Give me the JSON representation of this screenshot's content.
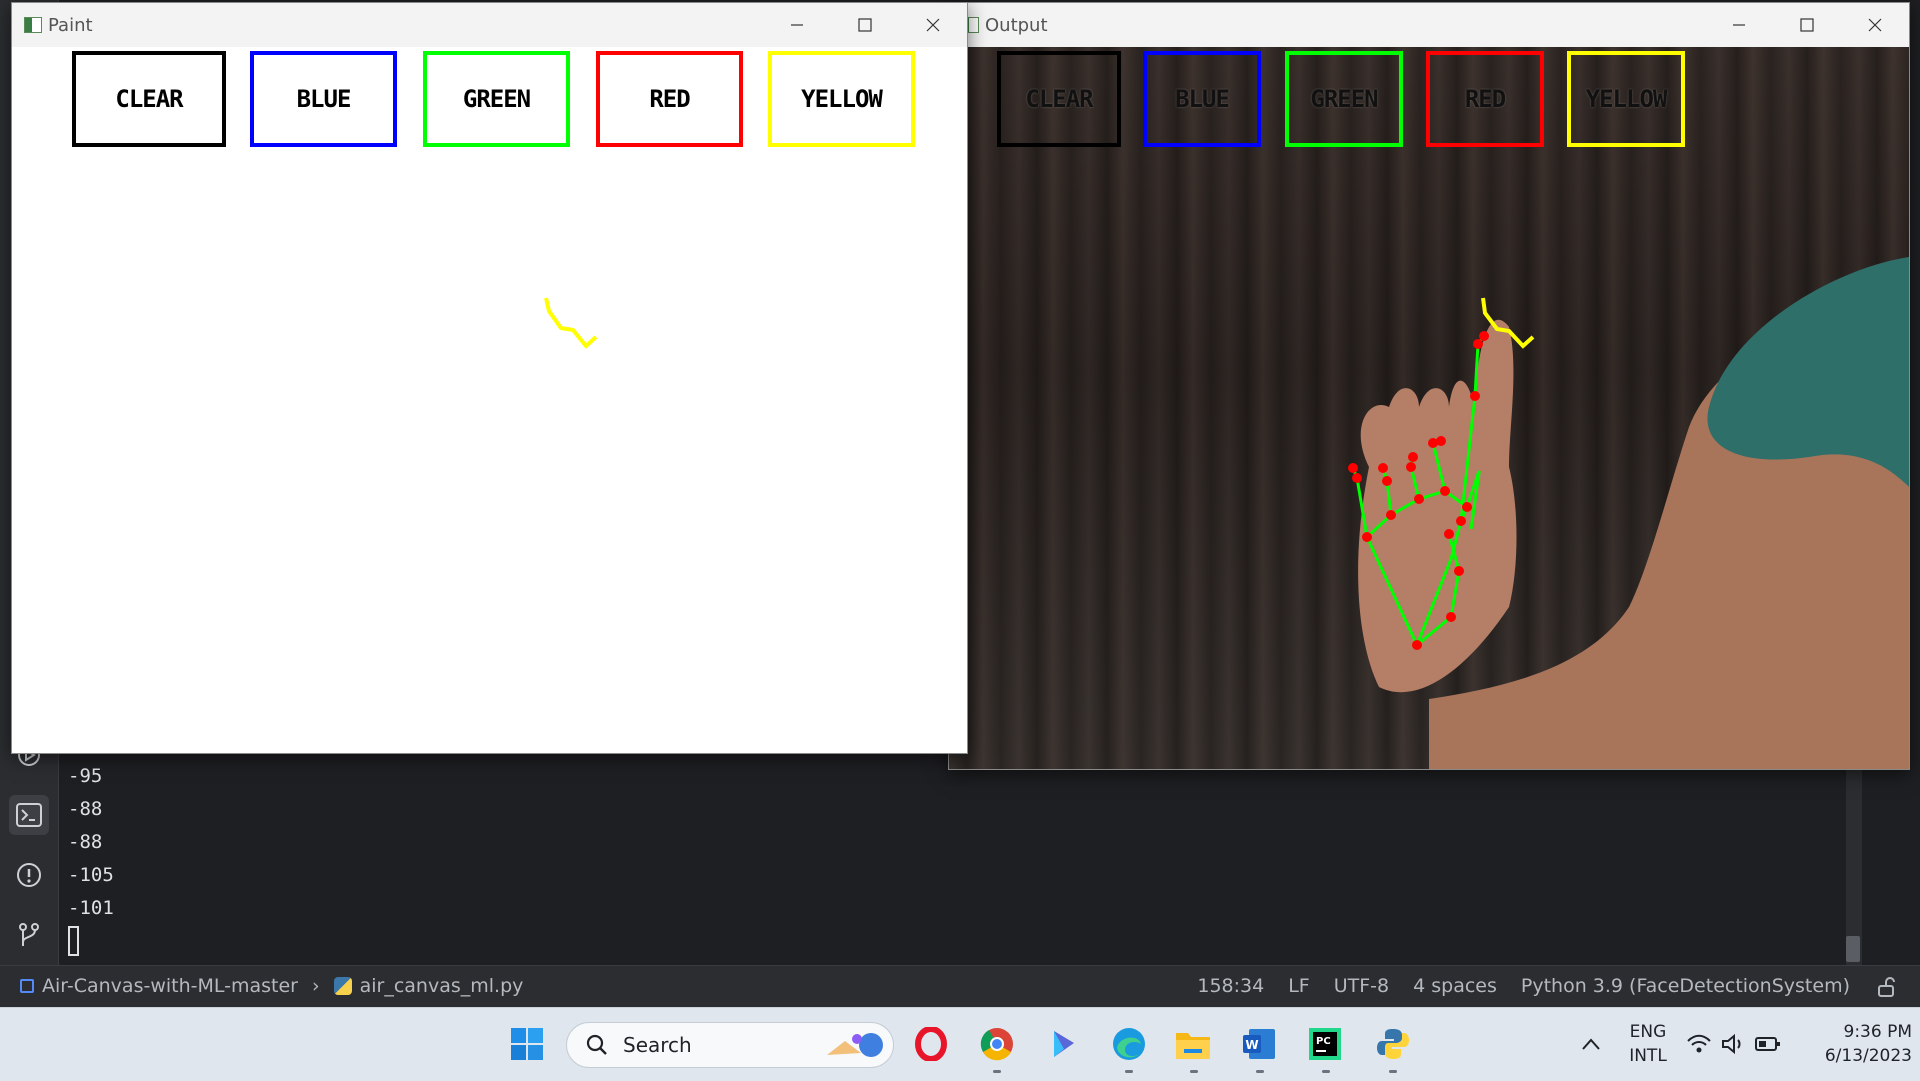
{
  "paint_window": {
    "title": "Paint",
    "buttons": [
      {
        "label": "CLEAR",
        "color": "#000000"
      },
      {
        "label": "BLUE",
        "color": "#0000ff"
      },
      {
        "label": "GREEN",
        "color": "#00ff00"
      },
      {
        "label": "RED",
        "color": "#ff0000"
      },
      {
        "label": "YELLOW",
        "color": "#ffff00"
      }
    ],
    "stroke_color": "#ffff00"
  },
  "output_window": {
    "title": "Output",
    "buttons": [
      {
        "label": "CLEAR",
        "color": "#000000"
      },
      {
        "label": "BLUE",
        "color": "#0000ff"
      },
      {
        "label": "GREEN",
        "color": "#00ff00"
      },
      {
        "label": "RED",
        "color": "#ff0000"
      },
      {
        "label": "YELLOW",
        "color": "#ffff00"
      }
    ],
    "landmark_color": "#ff0000",
    "connection_color": "#00ff00"
  },
  "console": {
    "lines": [
      "-95",
      "-88",
      "-88",
      "-105",
      "-101"
    ]
  },
  "status_bar": {
    "project": "Air-Canvas-with-ML-master",
    "file": "air_canvas_ml.py",
    "position": "158:34",
    "line_ending": "LF",
    "encoding": "UTF-8",
    "indent": "4 spaces",
    "interpreter": "Python 3.9 (FaceDetectionSystem)"
  },
  "taskbar": {
    "search_placeholder": "Search",
    "language": "ENG",
    "layout": "INTL",
    "time": "9:36 PM",
    "date": "6/13/2023"
  },
  "icons": [
    "minimize-icon",
    "maximize-icon",
    "close-icon",
    "run-icon",
    "terminal-icon",
    "problems-icon",
    "git-icon",
    "windows-start-icon",
    "search-icon",
    "opera-icon",
    "chrome-icon",
    "copilot-icon",
    "edge-icon",
    "file-explorer-icon",
    "word-icon",
    "pycharm-icon",
    "python-icon",
    "chevron-up-icon",
    "wifi-icon",
    "volume-icon",
    "battery-icon",
    "lock-icon"
  ]
}
